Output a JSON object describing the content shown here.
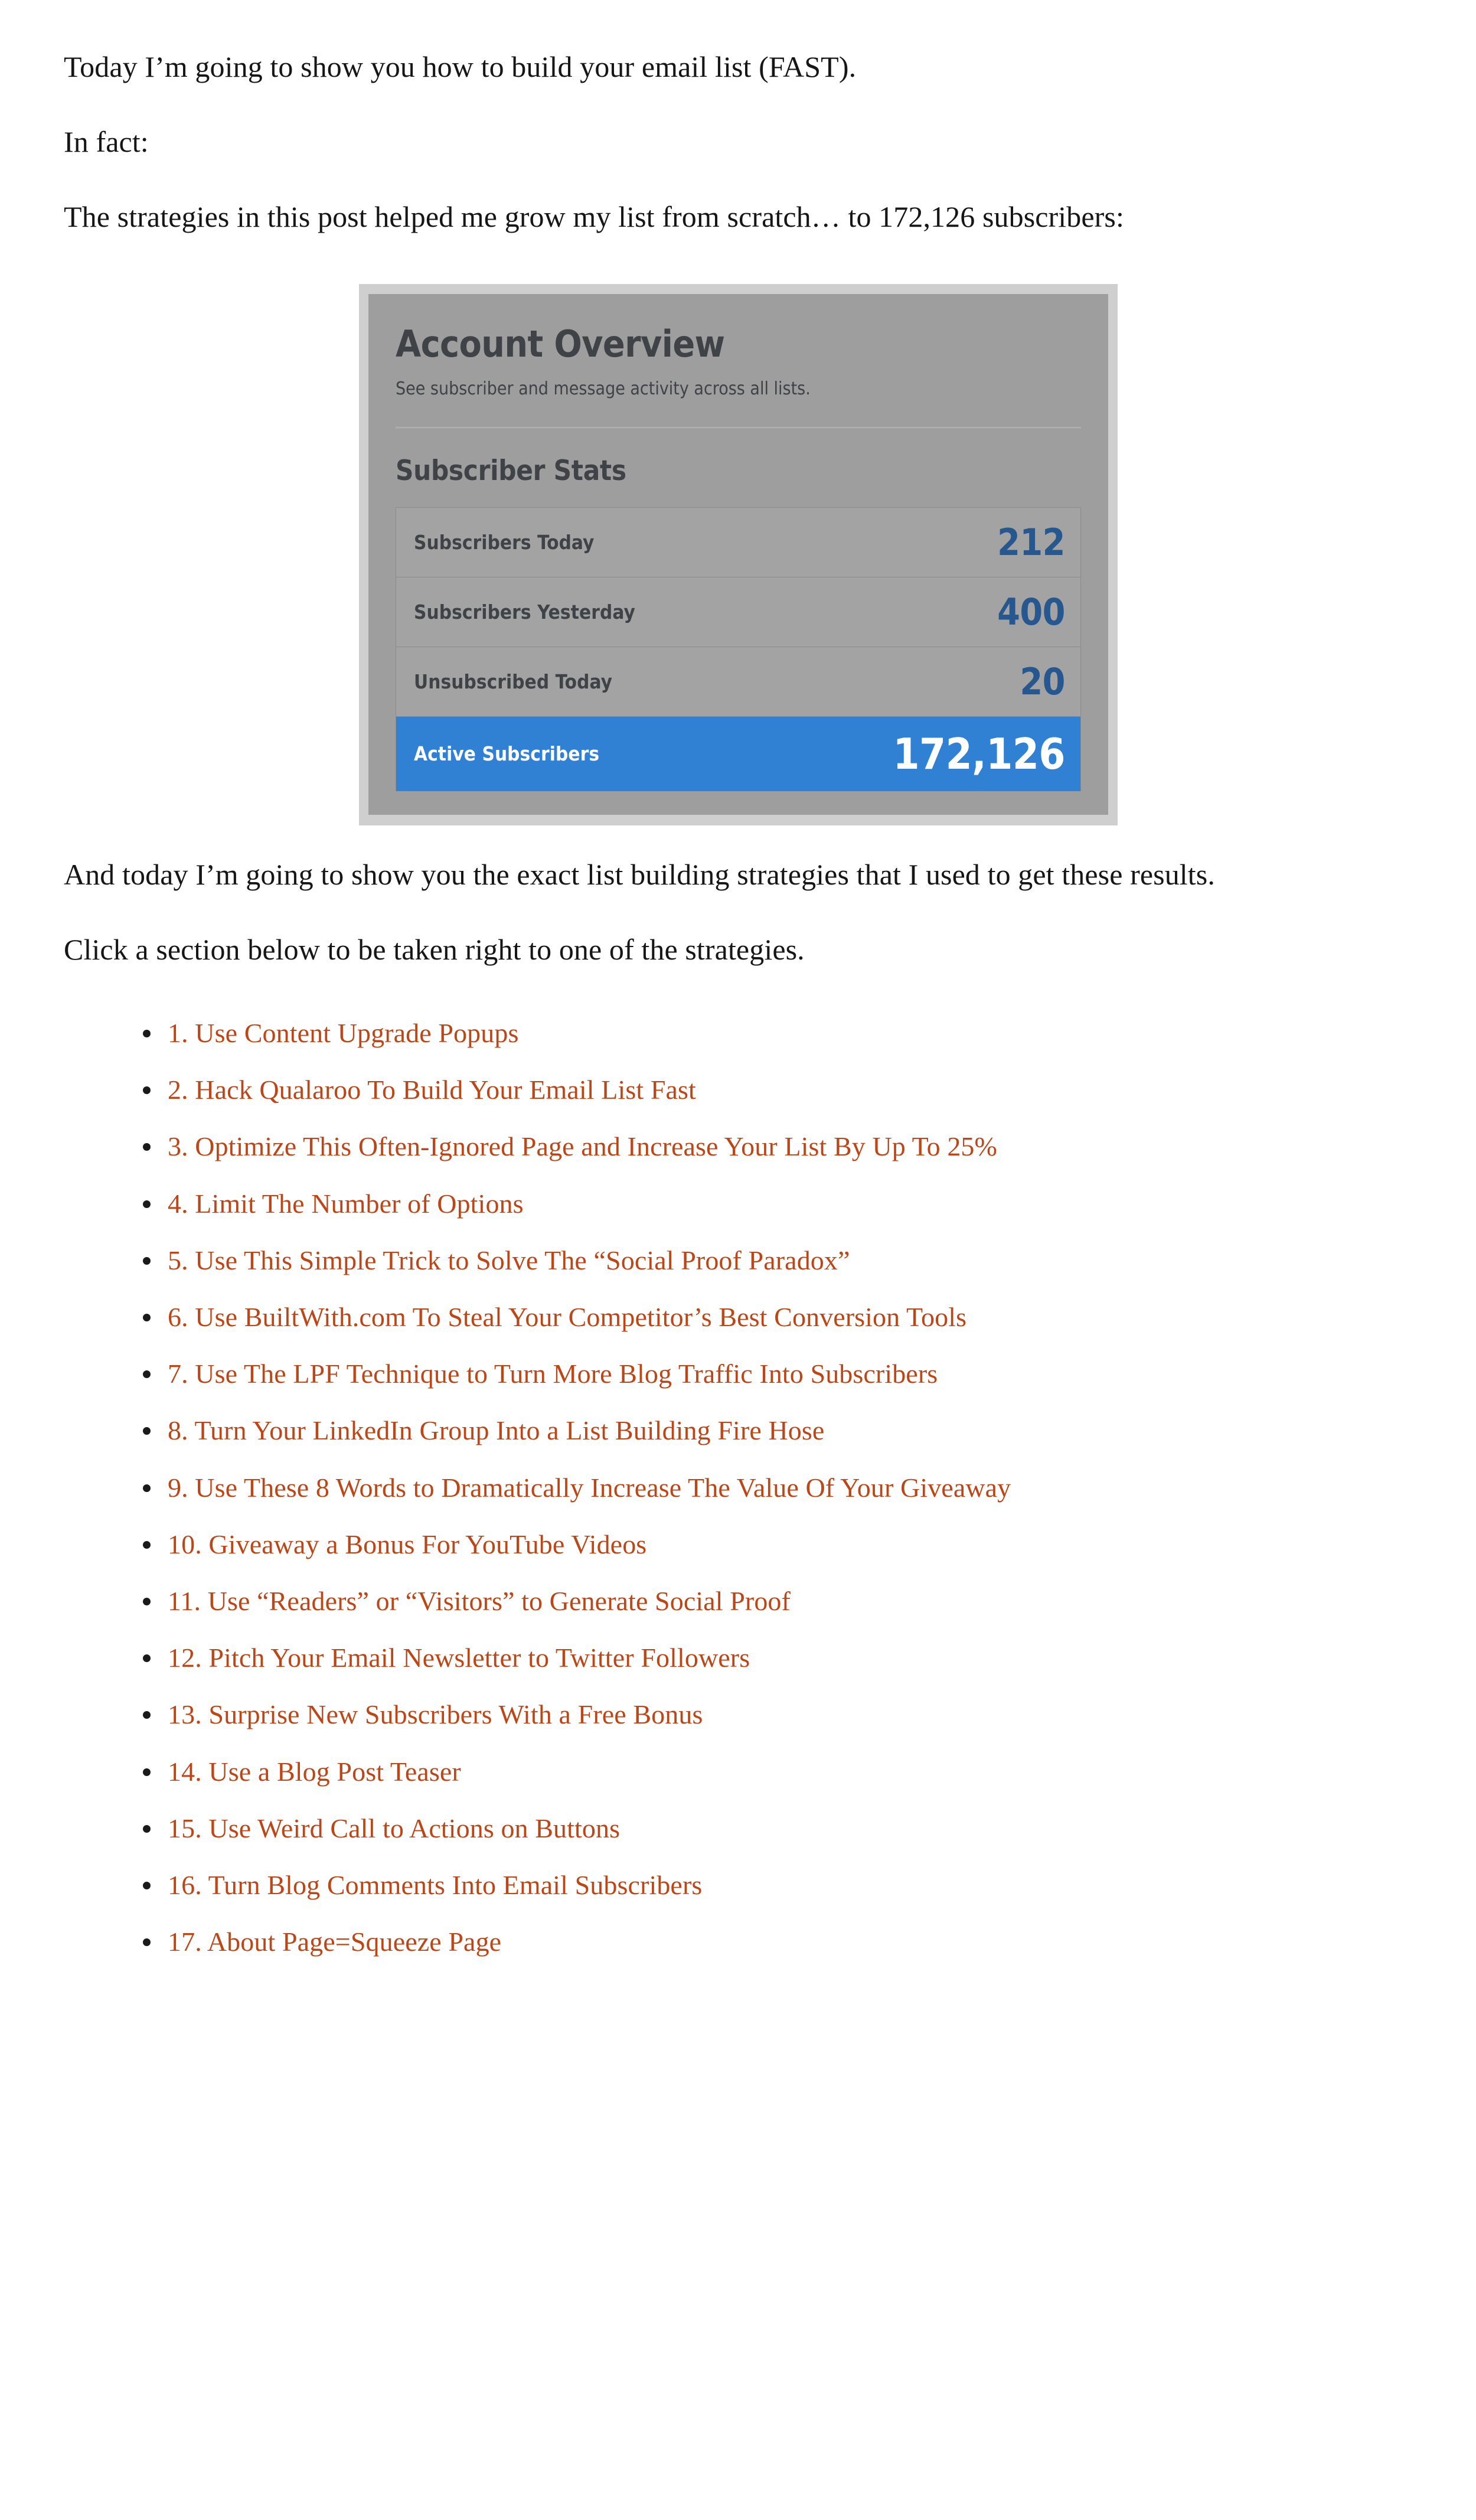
{
  "article": {
    "paragraphs": {
      "intro": "Today I’m going to show you how to build your email list (FAST).",
      "in_fact": "In fact:",
      "lead": "The strategies in this post helped me grow my list from scratch… to 172,126 subscribers:",
      "after_image": "And today I’m going to show you the exact list building strategies that I used to get these results.",
      "click_prompt": "Click a section below to be taken right to one of the strategies."
    }
  },
  "screenshot": {
    "title": "Account Overview",
    "subtitle": "See subscriber and message activity across all lists.",
    "section_title": "Subscriber Stats",
    "colors": {
      "frame": "#cfcfcf",
      "panel": "#9e9e9e",
      "table": "#a3a3a3",
      "value_blue": "#26588f",
      "highlight_blue": "#3081d4",
      "heading_text": "#3f4347"
    },
    "stats": [
      {
        "label": "Subscribers Today",
        "value": "212",
        "highlighted": false
      },
      {
        "label": "Subscribers Yesterday",
        "value": "400",
        "highlighted": false
      },
      {
        "label": "Unsubscribed Today",
        "value": "20",
        "highlighted": false
      },
      {
        "label": "Active Subscribers",
        "value": "172,126",
        "highlighted": true
      }
    ]
  },
  "strategies": {
    "link_color": "#bb4718",
    "items": [
      {
        "label": "1. Use Content Upgrade Popups"
      },
      {
        "label": "2. Hack Qualaroo To Build Your Email List Fast"
      },
      {
        "label": "3. Optimize This Often-Ignored Page and Increase Your List By Up To 25%"
      },
      {
        "label": "4. Limit The Number of Options"
      },
      {
        "label": "5. Use This Simple Trick to Solve The “Social Proof Paradox”"
      },
      {
        "label": "6. Use BuiltWith.com To Steal Your Competitor’s Best Conversion Tools"
      },
      {
        "label": "7. Use The LPF Technique to Turn More Blog Traffic Into Subscribers"
      },
      {
        "label": "8. Turn Your LinkedIn Group Into a List Building Fire Hose"
      },
      {
        "label": "9. Use These 8 Words to Dramatically Increase The Value Of Your Giveaway"
      },
      {
        "label": "10. Giveaway a Bonus For YouTube Videos"
      },
      {
        "label": "11. Use “Readers” or “Visitors” to Generate Social Proof"
      },
      {
        "label": "12. Pitch Your Email Newsletter to Twitter Followers"
      },
      {
        "label": "13. Surprise New Subscribers With a Free Bonus"
      },
      {
        "label": "14. Use a Blog Post Teaser"
      },
      {
        "label": "15. Use Weird Call to Actions on Buttons"
      },
      {
        "label": "16. Turn Blog Comments Into Email Subscribers"
      },
      {
        "label": "17. About Page=Squeeze Page"
      }
    ]
  }
}
